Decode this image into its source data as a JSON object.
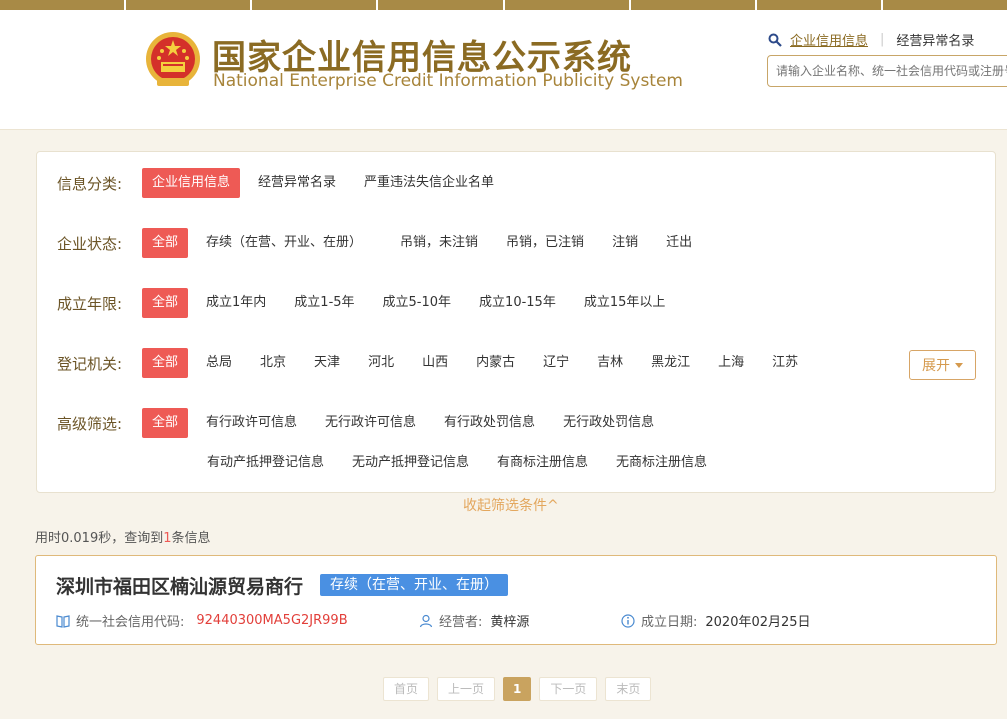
{
  "header": {
    "title_cn": "国家企业信用信息公示系统",
    "title_en": "National Enterprise Credit Information Publicity System",
    "link_credit": "企业信用信息",
    "link_abnormal": "经营异常名录",
    "search_placeholder": "请输入企业名称、统一社会信用代码或注册号"
  },
  "filters": {
    "category": {
      "label": "信息分类:",
      "options": [
        "企业信用信息",
        "经营异常名录",
        "严重违法失信企业名单"
      ]
    },
    "status": {
      "label": "企业状态:",
      "options": [
        "全部",
        "存续（在营、开业、在册）",
        "吊销，未注销",
        "吊销，已注销",
        "注销",
        "迁出"
      ]
    },
    "years": {
      "label": "成立年限:",
      "options": [
        "全部",
        "成立1年内",
        "成立1-5年",
        "成立5-10年",
        "成立10-15年",
        "成立15年以上"
      ]
    },
    "authority": {
      "label": "登记机关:",
      "options": [
        "全部",
        "总局",
        "北京",
        "天津",
        "河北",
        "山西",
        "内蒙古",
        "辽宁",
        "吉林",
        "黑龙江",
        "上海",
        "江苏"
      ],
      "expand_label": "展开"
    },
    "advanced": {
      "label": "高级筛选:",
      "options": [
        "全部",
        "有行政许可信息",
        "无行政许可信息",
        "有行政处罚信息",
        "无行政处罚信息"
      ],
      "options_row2": [
        "有动产抵押登记信息",
        "无动产抵押登记信息",
        "有商标注册信息",
        "无商标注册信息"
      ]
    }
  },
  "collapse_label": "收起筛选条件^",
  "stats": {
    "prefix": "用时0.019秒，查询到",
    "count": "1",
    "suffix": "条信息"
  },
  "result": {
    "company_name": "深圳市福田区楠汕源贸易商行",
    "status": "存续（在营、开业、在册）",
    "credit_code_label": "统一社会信用代码:",
    "credit_code": "92440300MA5G2JR99B",
    "operator_label": "经营者:",
    "operator": "黄梓源",
    "date_label": "成立日期:",
    "date": "2020年02月25日"
  },
  "pagination": {
    "first": "首页",
    "prev": "上一页",
    "current": "1",
    "next": "下一页",
    "last": "末页"
  },
  "colors": {
    "brand_gold": "#8b6b23",
    "active_red": "#ee5a55",
    "status_blue": "#4a90e2",
    "code_red": "#e23f3a"
  }
}
